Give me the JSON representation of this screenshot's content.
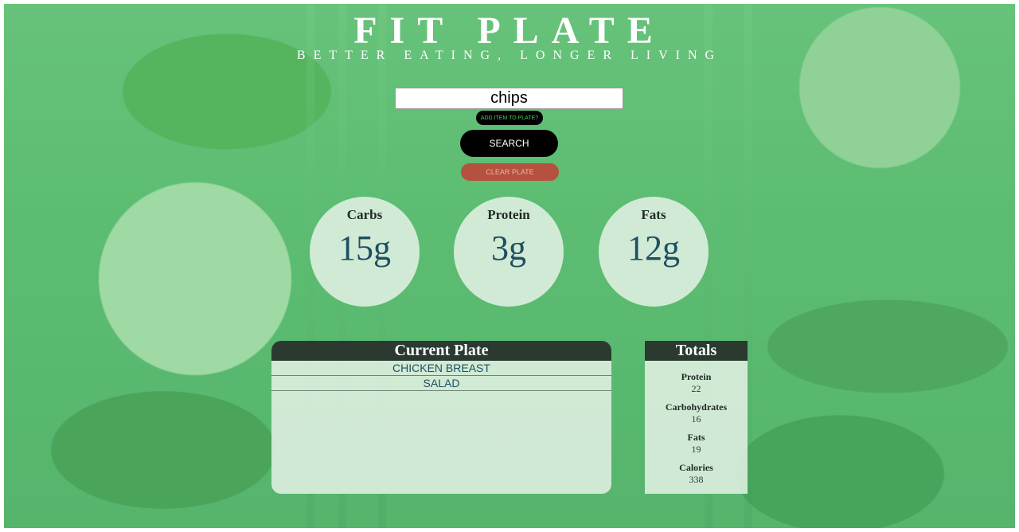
{
  "header": {
    "title": "FIT PLATE",
    "subtitle": "BETTER EATING, LONGER LIVING"
  },
  "search": {
    "value": "chips",
    "add_label": "ADD ITEM TO PLATE?",
    "search_label": "SEARCH",
    "clear_label": "CLEAR PLATE"
  },
  "macros": {
    "carbs": {
      "label": "Carbs",
      "value": "15g"
    },
    "protein": {
      "label": "Protein",
      "value": "3g"
    },
    "fats": {
      "label": "Fats",
      "value": "12g"
    }
  },
  "plate": {
    "title": "Current Plate",
    "items": [
      "CHICKEN BREAST",
      "SALAD"
    ]
  },
  "totals": {
    "title": "Totals",
    "rows": [
      {
        "label": "Protein",
        "value": "22"
      },
      {
        "label": "Carbohydrates",
        "value": "16"
      },
      {
        "label": "Fats",
        "value": "19"
      },
      {
        "label": "Calories",
        "value": "338"
      }
    ]
  },
  "colors": {
    "background_green": "#5cbd72",
    "header_dark": "#2a3a31",
    "value_blue": "#1d4f63",
    "clear_red": "#b5513e",
    "add_text_green": "#3ecf57"
  }
}
